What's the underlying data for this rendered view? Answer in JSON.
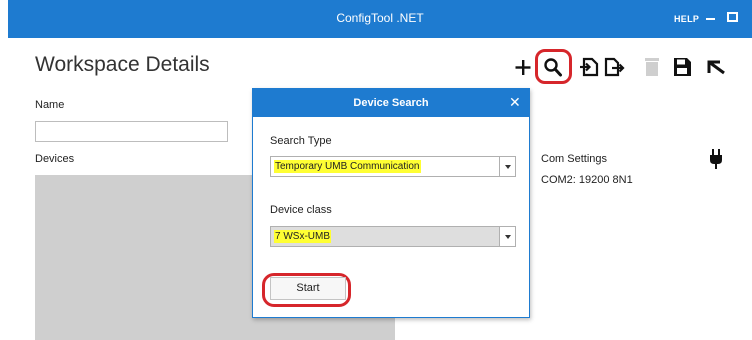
{
  "window": {
    "title": "ConfigTool .NET",
    "help_label": "HELP",
    "accent_color": "#1e7bd0",
    "controls": [
      "minimize-icon",
      "maximize-icon",
      "close-icon"
    ]
  },
  "workspace": {
    "title": "Workspace Details",
    "name_label": "Name",
    "name_value": "",
    "devices_label": "Devices",
    "com_settings_label": "Com Settings",
    "com_settings_value": "COM2: 19200 8N1"
  },
  "toolbar": {
    "icons": [
      "add-icon",
      "search-icon",
      "import-icon",
      "export-icon",
      "delete-icon",
      "save-icon",
      "undo-icon"
    ],
    "highlighted": "search-icon",
    "highlight_color": "#d6262b"
  },
  "dialog": {
    "title": "Device Search",
    "close_glyph": "✕",
    "search_type_label": "Search Type",
    "search_type_value": "Temporary UMB Communication",
    "device_class_label": "Device class",
    "device_class_value": "7 WSx-UMB",
    "start_label": "Start",
    "highlight_color": "#ffff33"
  }
}
